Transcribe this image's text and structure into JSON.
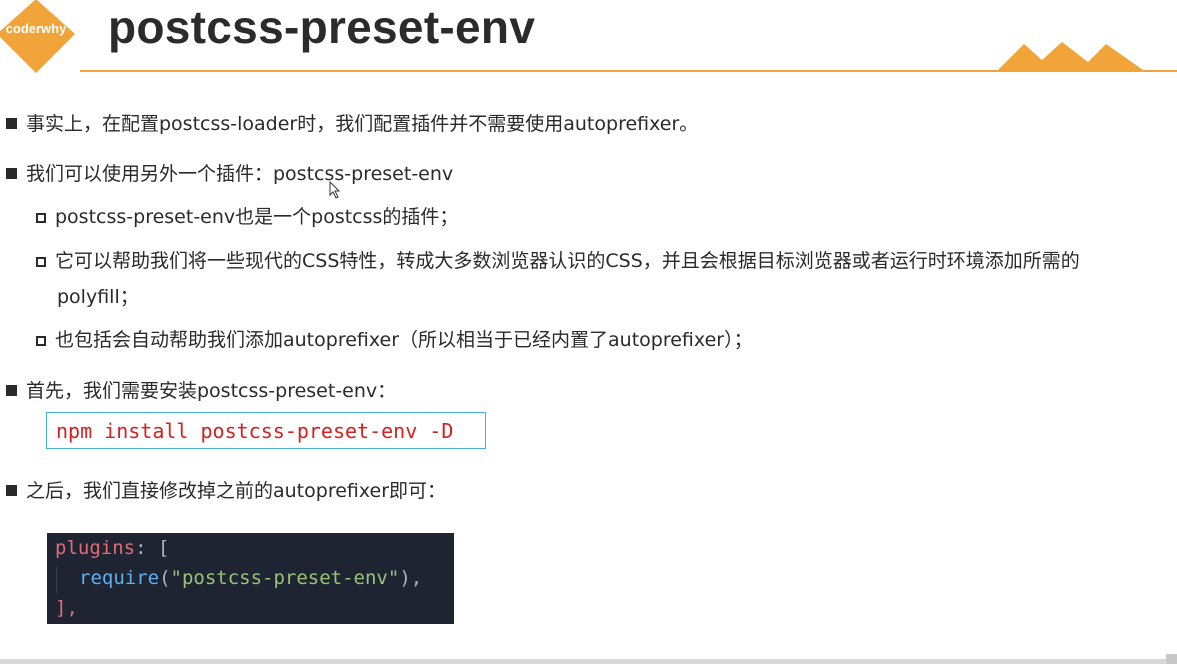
{
  "logo": {
    "text": "coderwhy"
  },
  "header": {
    "title": "postcss-preset-env"
  },
  "bullets": [
    {
      "text": "事实上，在配置postcss-loader时，我们配置插件并不需要使用autoprefixer。"
    },
    {
      "text": "我们可以使用另外一个插件：postcss-preset-env"
    },
    {
      "text": "首先，我们需要安装postcss-preset-env："
    },
    {
      "text": "之后，我们直接修改掉之前的autoprefixer即可："
    }
  ],
  "sub_bullets": [
    {
      "text": "postcss-preset-env也是一个postcss的插件；"
    },
    {
      "line1": "它可以帮助我们将一些现代的CSS特性，转成大多数浏览器认识的CSS，并且会根据目标浏览器或者运行时环境添加所需的",
      "line2": "polyfill；"
    },
    {
      "text": "也包括会自动帮助我们添加autoprefixer（所以相当于已经内置了autoprefixer）；"
    }
  ],
  "command": "npm install postcss-preset-env -D",
  "code": {
    "line1_key": "plugins",
    "line1_punct": ": [",
    "line2_fn": "require",
    "line2_open": "(",
    "line2_str": "\"postcss-preset-env\"",
    "line2_close": "),",
    "line3": "],"
  },
  "colors": {
    "accent": "#f0a43a",
    "command_text": "#d4201f",
    "command_border": "#47b0d8",
    "code_bg": "#1e2432"
  }
}
